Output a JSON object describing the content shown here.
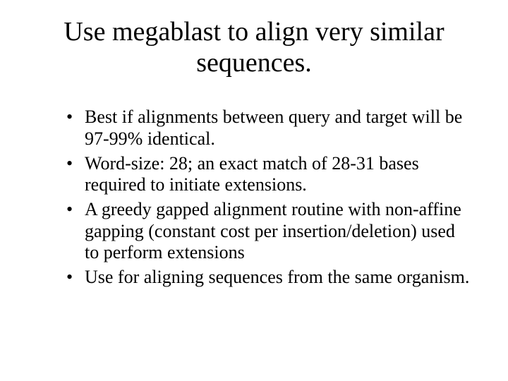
{
  "title": "Use megablast to align very similar sequences.",
  "bullets": [
    "Best if alignments between query and target will be 97-99% identical.",
    "Word-size: 28; an exact match of 28-31 bases required to initiate extensions.",
    "A greedy gapped alignment routine with non-affine gapping (constant cost per insertion/deletion) used to perform extensions",
    "Use for aligning sequences from the same organism."
  ]
}
